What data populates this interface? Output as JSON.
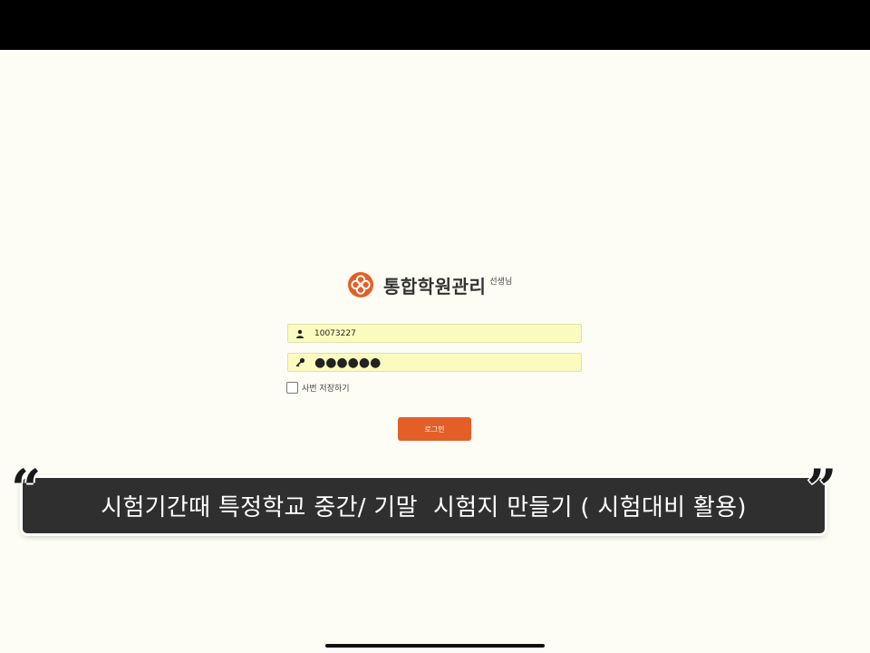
{
  "app": {
    "title": "통합학원관리",
    "title_suffix": "선생님",
    "brand_color": "#e35f27"
  },
  "login": {
    "id_value": "10073227",
    "id_icon": "user-icon",
    "password_value": "●●●●●●",
    "password_icon": "key-icon",
    "field_background": "#fbfbbf",
    "remember_label": "사번 저장하기",
    "remember_checked": false,
    "submit_label": "로그인"
  },
  "caption": {
    "open_quote": "“",
    "text": "시험기간때 특정학교 중간/ 기말  시험지 만들기 ( 시험대비 활용)",
    "close_quote": "”"
  }
}
